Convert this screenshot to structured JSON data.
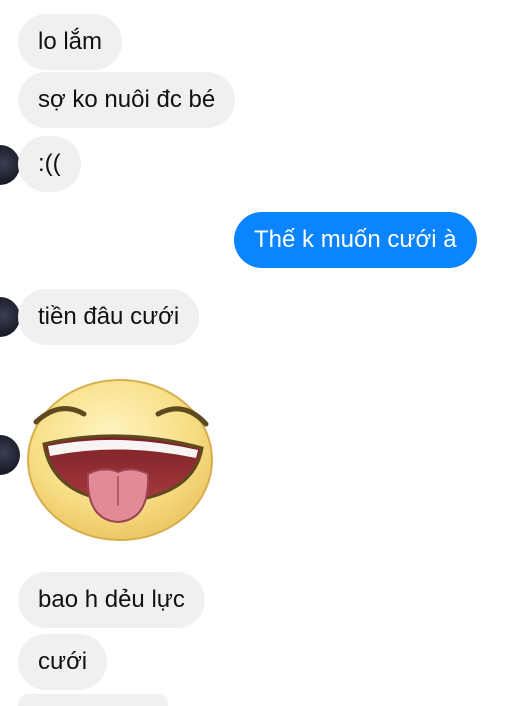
{
  "conversation": {
    "messages": [
      {
        "sender": "them",
        "text": "lo lắm"
      },
      {
        "sender": "them",
        "text": "sợ ko nuôi đc bé"
      },
      {
        "sender": "them",
        "text": ":(("
      },
      {
        "sender": "me",
        "text": "Thế k muốn cưới à"
      },
      {
        "sender": "them",
        "text": "tiền đâu cưới"
      },
      {
        "sender": "them",
        "sticker": "laughing-tongue-out-emoji"
      },
      {
        "sender": "them",
        "text": "bao h dẻu lực"
      },
      {
        "sender": "them",
        "text": "cưới"
      }
    ]
  },
  "colors": {
    "incoming_bubble": "#f0f0f0",
    "outgoing_bubble": "#0b84ff",
    "incoming_text": "#111111",
    "outgoing_text": "#ffffff"
  }
}
